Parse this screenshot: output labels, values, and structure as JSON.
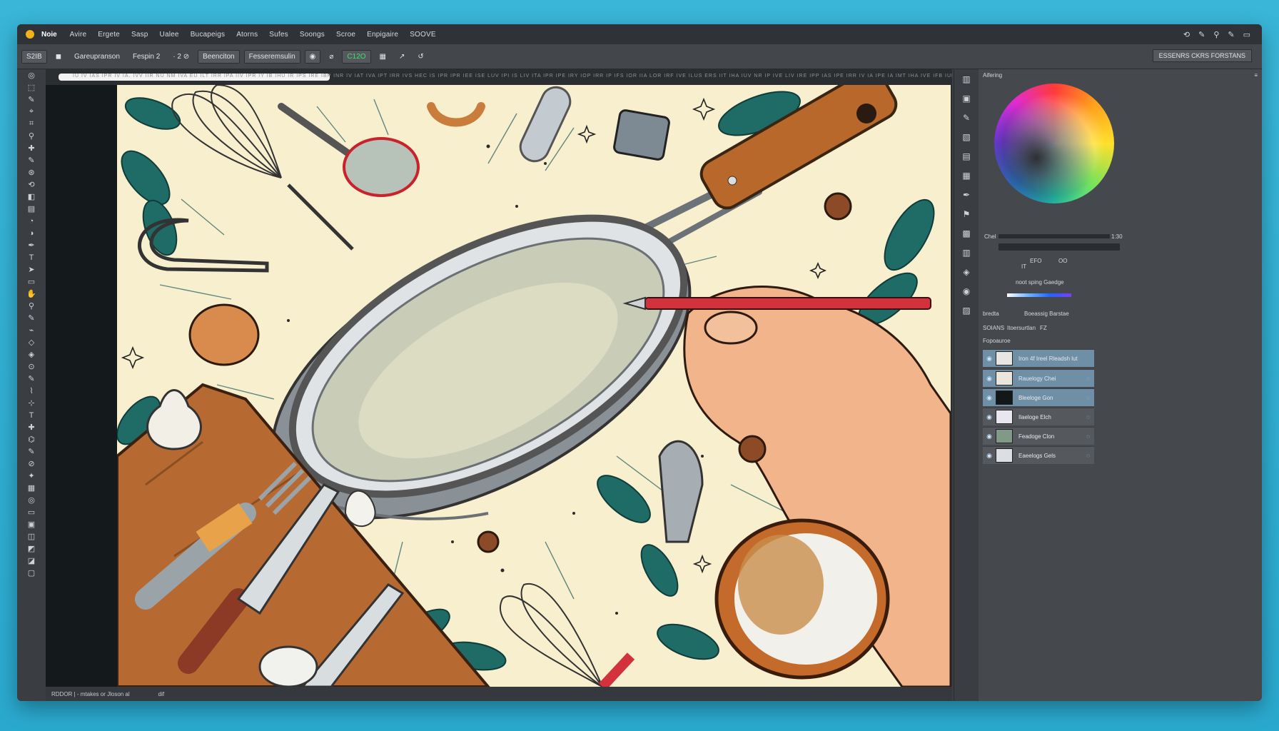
{
  "menubar": {
    "app_name": "Noie",
    "items": [
      "Avire",
      "Ergete",
      "Sasp",
      "Ualee",
      "Bucapeigs",
      "Atorns",
      "Sufes",
      "Soongs",
      "Scroe",
      "Enpigaire",
      "SOOVE"
    ],
    "right_icons": [
      "⟲",
      "✎",
      "⚲",
      "✎",
      "▭"
    ]
  },
  "options": {
    "preset": "S2IB",
    "preset2": "Gareupranson",
    "field1": "Fespin 2",
    "field2": "· 2 ⊘",
    "tool_name": "Beenciton",
    "field3": "Fesseremsulin",
    "zoom": "C12O",
    "right_button": "ESSENRS CKRS FORSTANS"
  },
  "ruler": {
    "text": "IU IV IAS IPR IV IA. IVV IIR NU NM IVA EU ILT IRR IPA IIV IPR IY IB IHU IR IPS IRE IBP INR IV IAT IVA IPT IRR IVS HEC IS IPR IPR IEE ISE LUV IPI IS LIV ITA IPR IPE IRY IOP IRR IP IFS IOR IIA LOR IRF IVE ILUS ERS IIT IHA IUV NR IP IVE LIV IRE IPP IAS IPE IRR IV IA IPE IA IMT IHA IVE IFB IUP IT"
  },
  "status": {
    "left": "RDDOR | - mtakes or Jloson al",
    "mid": "dif"
  },
  "panel": {
    "title": "Aifering",
    "color_label": "Chel",
    "color_value": "1:30",
    "mini1": "IT",
    "mini2": "EFO",
    "mini3": "OO",
    "caption": "noot sping Gaedge",
    "tab1": "bredta",
    "tab2": "Boeassig Barstae",
    "layers_tab": "SOIANS",
    "layers_tab2": "Itoersurtlan",
    "layers_tab3": "FZ",
    "layers_head": "Fopoauroe",
    "group_name": "Iron 4f Ireel Rleadsh lut"
  },
  "layers": [
    {
      "name": "Rauelogy Chei",
      "thumb": "#eae6dc",
      "selected": true
    },
    {
      "name": "Bleeloge Gon",
      "thumb": "#121818",
      "selected": true
    },
    {
      "name": "Ilaeloge Elch",
      "thumb": "#e9e6f0",
      "selected": false
    },
    {
      "name": "Feadoge Clon",
      "thumb": "#7f9a86",
      "selected": false
    },
    {
      "name": "Eaeelogs Gels",
      "thumb": "#dddde4",
      "selected": false
    }
  ],
  "colors": {
    "accent": "#f2b21b",
    "selection": "#6f8fa6",
    "artboard": "#f8efcf"
  }
}
